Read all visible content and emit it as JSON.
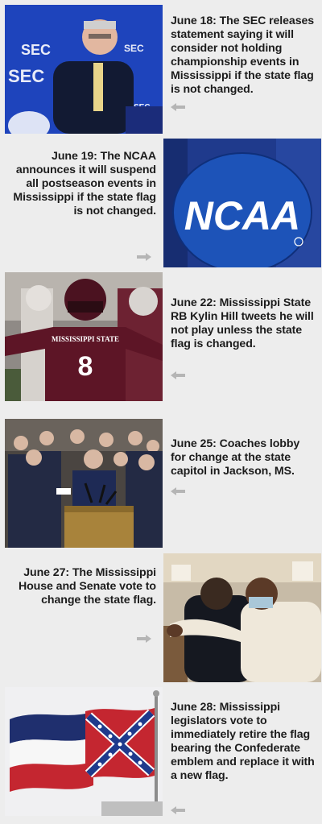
{
  "events": [
    {
      "text": "June 18: The SEC releases statement saying it will consider not holding championship events in Mississippi if the state flag is not changed.",
      "photo": "SEC commissioner speaking at podium before SEC logo backdrop",
      "logo_text": "SEC",
      "arrow": "left"
    },
    {
      "text": "June 19: The NCAA announces it will suspend all postseason events in Mississippi if the state flag is not changed.",
      "photo": "NCAA logo disc",
      "logo_text": "NCAA",
      "arrow": "right"
    },
    {
      "text": "June 22: Mississippi State RB Kylin Hill tweets he will not play unless the state flag is changed.",
      "photo": "Mississippi State football player number 8",
      "logo_text": "MISSISSIPPI STATE",
      "jersey_number": "8",
      "arrow": "left"
    },
    {
      "text": "June 25: Coaches lobby for change at the state capitol in Jackson, MS.",
      "photo": "Coaches at lectern with microphones at state capitol",
      "arrow": "left"
    },
    {
      "text": "June 27: The Mississippi House and Senate vote to change the state flag.",
      "photo": "Legislators embracing in the chamber",
      "arrow": "right"
    },
    {
      "text": "June 28: Mississippi legislators vote to immediately retire the flag bearing the Confederate emblem and replace it with a new flag.",
      "photo": "Former Mississippi state flag with Confederate emblem flying",
      "arrow": "left"
    }
  ],
  "colors": {
    "background": "#ededed",
    "text": "#1c1c1c",
    "arrow": "#b5b5b5",
    "ncaa_blue": "#1d53b8",
    "maroon": "#5d1526"
  }
}
